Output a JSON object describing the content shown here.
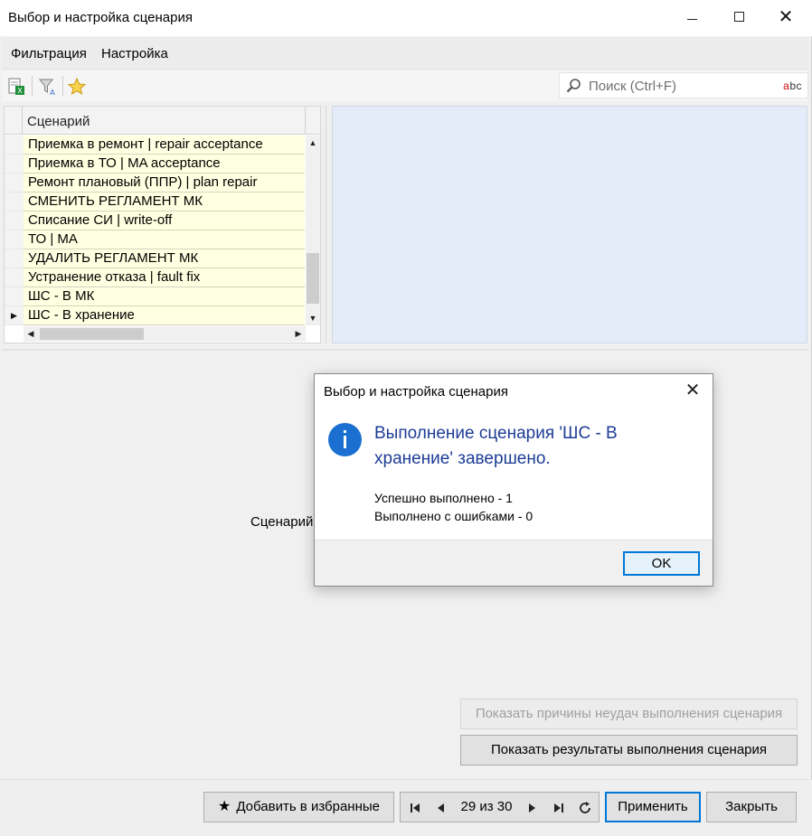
{
  "window": {
    "title": "Выбор и настройка сценария"
  },
  "menu": {
    "items": [
      "Фильтрация",
      "Настройка"
    ]
  },
  "search": {
    "placeholder": "Поиск (Ctrl+F)",
    "value": "",
    "spell_label": "abc"
  },
  "grid": {
    "column_header": "Сценарий",
    "rows": [
      {
        "label": "Приемка в ремонт | repair acceptance",
        "current": false
      },
      {
        "label": "Приемка в ТО | MA acceptance",
        "current": false
      },
      {
        "label": "Ремонт плановый (ППР) | plan repair",
        "current": false
      },
      {
        "label": "СМЕНИТЬ РЕГЛАМЕНТ МК",
        "current": false
      },
      {
        "label": "Списание СИ | write-off",
        "current": false
      },
      {
        "label": "ТО | MA",
        "current": false
      },
      {
        "label": "УДАЛИТЬ РЕГЛАМЕНТ МК",
        "current": false
      },
      {
        "label": "Устранение отказа | fault fix",
        "current": false
      },
      {
        "label": "ШС - В МК",
        "current": false
      },
      {
        "label": "ШС - В хранение",
        "current": true
      }
    ],
    "current_indicator": "▶"
  },
  "lower": {
    "label": "Сценарий"
  },
  "actions": {
    "show_failures": "Показать причины неудач выполнения сценария",
    "show_results": "Показать результаты выполнения сценария"
  },
  "bottom": {
    "favorite": "Добавить в избранные",
    "position": "29 из 30",
    "apply": "Применить",
    "close": "Закрыть"
  },
  "dialog": {
    "title": "Выбор и настройка сценария",
    "heading": "Выполнение сценария 'ШС - В хранение' завершено.",
    "line1": "Успешно выполнено - 1",
    "line2": "Выполнено с ошибками - 0",
    "ok": "OK"
  },
  "colors": {
    "row_bg": "#ffffe1",
    "preview_bg": "#e3ecf8",
    "accent": "#0078d7",
    "dialog_heading": "#1d3c96"
  }
}
